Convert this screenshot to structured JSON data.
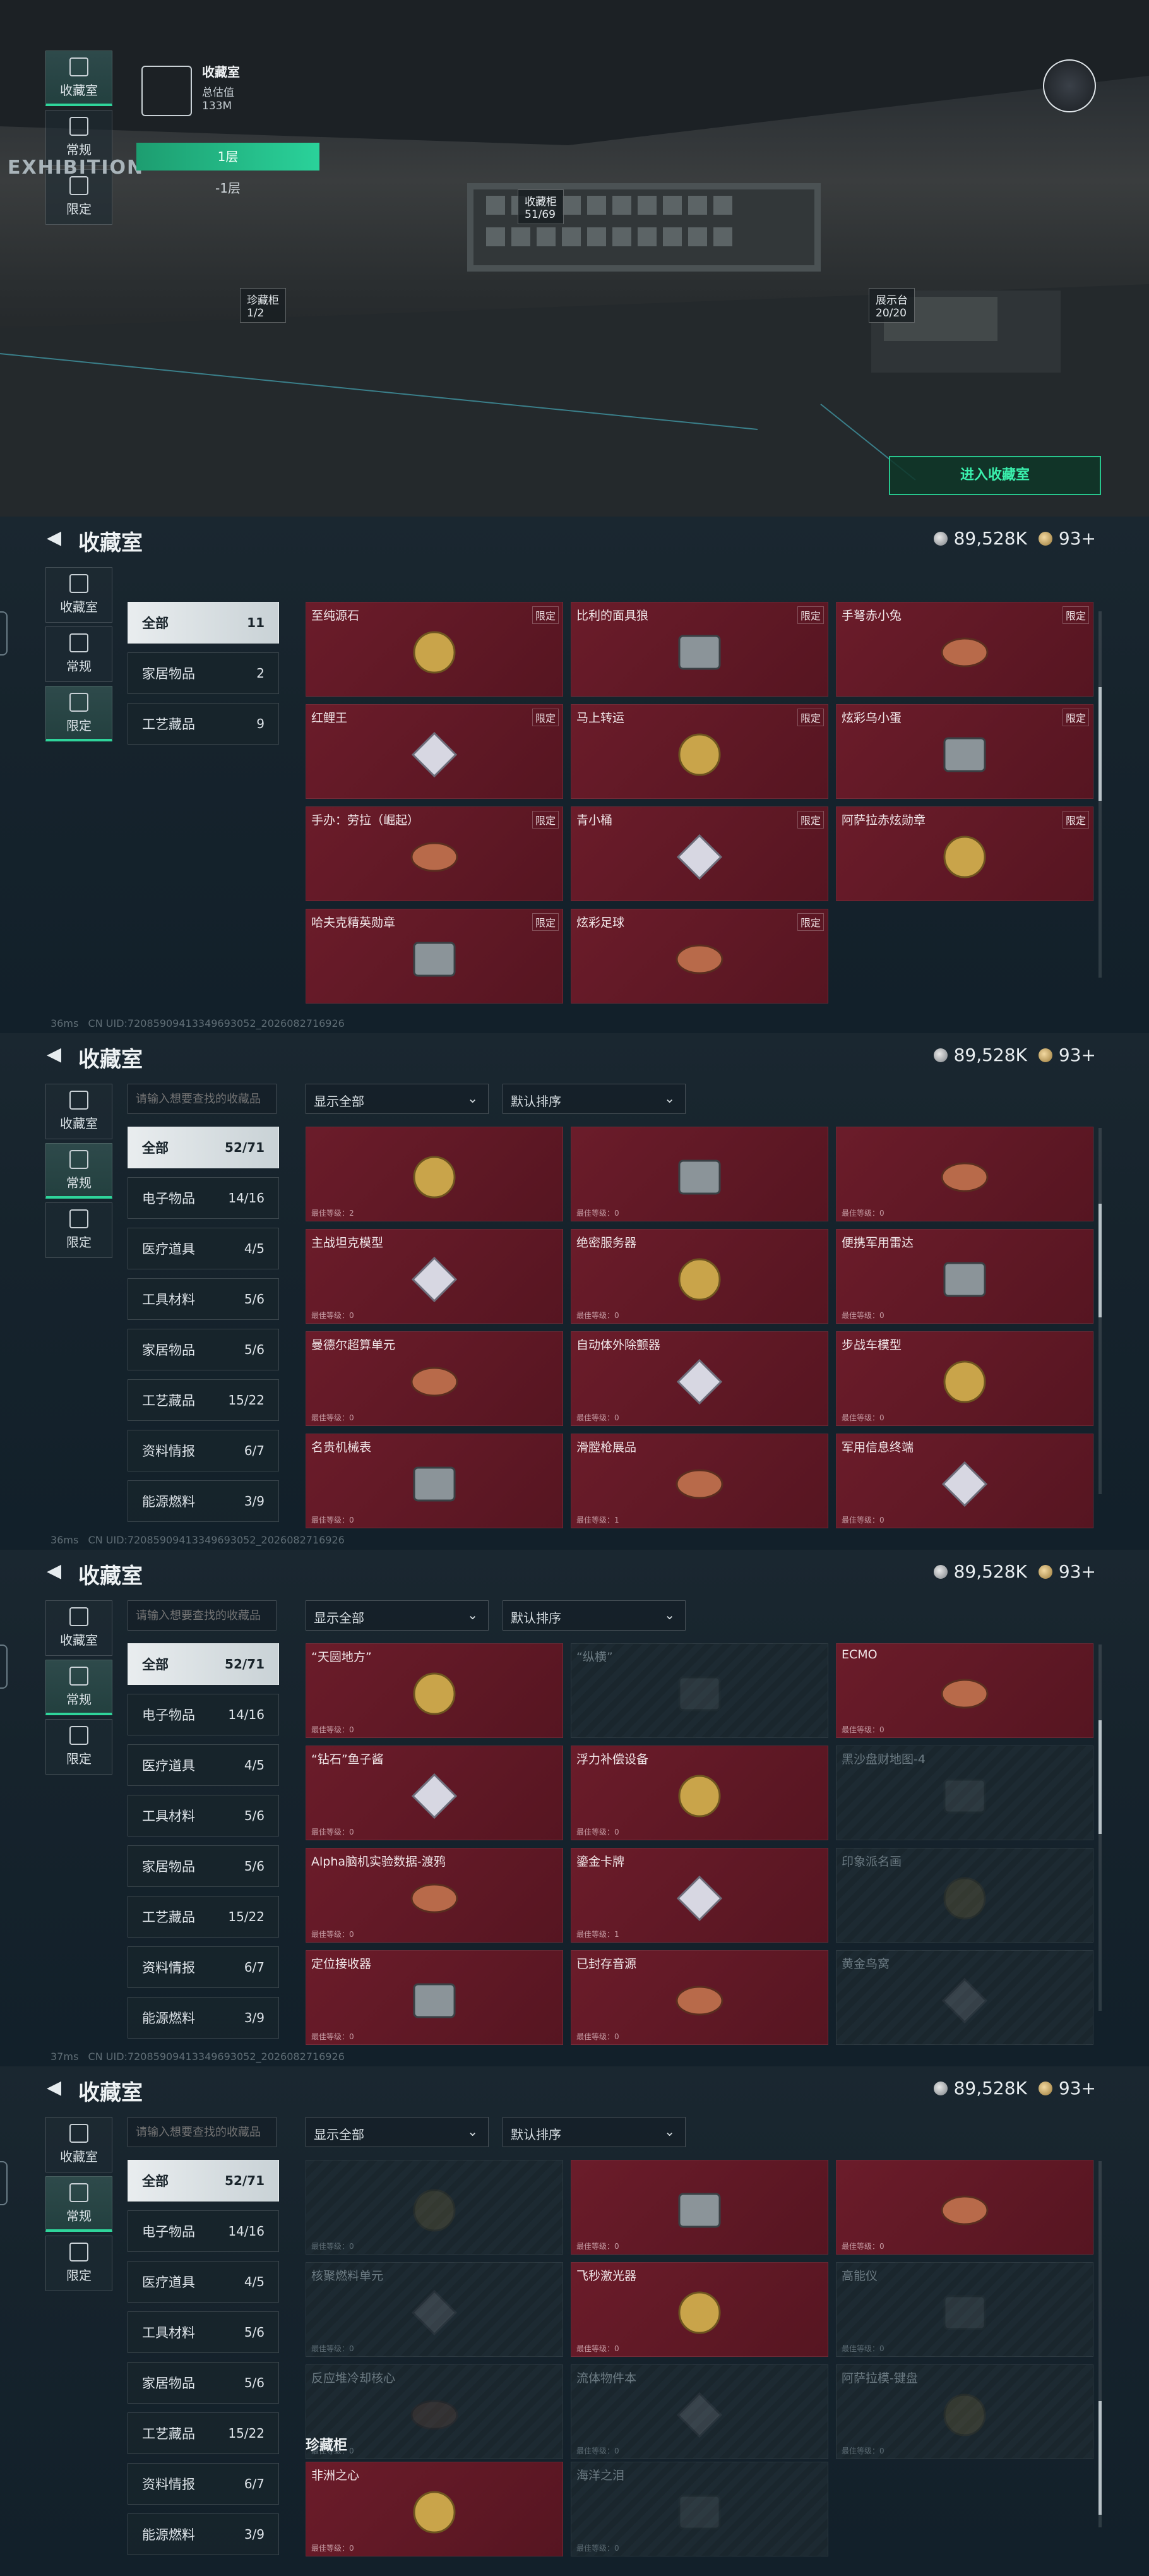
{
  "header": {
    "title": "收藏室",
    "coins": "89,528K",
    "gems": "93+"
  },
  "nav": [
    {
      "label": "收藏室"
    },
    {
      "label": "常规"
    },
    {
      "label": "限定"
    }
  ],
  "scene": {
    "room_label": "收藏室",
    "room_sub": "总估值",
    "room_value": "133M",
    "floor_1": "1层",
    "floor_neg1": "-1层",
    "exhibition": "EXHIBITION",
    "tag_cabinet": "收藏柜",
    "tag_cabinet_count": "51/69",
    "tag_treasure": "珍藏柜",
    "tag_treasure_count": "1/2",
    "tag_display": "展示台",
    "tag_display_count": "20/20",
    "enter": "进入收藏室"
  },
  "footer": {
    "uid": "CN UID:72085909413349693052_2026082716926",
    "ping2": "36ms",
    "ping3": "36ms",
    "ping4": "37ms"
  },
  "limited": {
    "cats": [
      {
        "name": "全部",
        "count": "11"
      },
      {
        "name": "家居物品",
        "count": "2"
      },
      {
        "name": "工艺藏品",
        "count": "9"
      }
    ],
    "items": [
      {
        "name": "至纯源石",
        "tag": "限定"
      },
      {
        "name": "比利的面具狼",
        "tag": "限定"
      },
      {
        "name": "手弩赤小兔",
        "tag": "限定"
      },
      {
        "name": "红鲤王",
        "tag": "限定"
      },
      {
        "name": "马上转运",
        "tag": "限定"
      },
      {
        "name": "炫彩乌小蛋",
        "tag": "限定"
      },
      {
        "name": "手办：劳拉（崛起）",
        "tag": "限定"
      },
      {
        "name": "青小桶",
        "tag": "限定"
      },
      {
        "name": "阿萨拉赤炫勋章",
        "tag": "限定"
      },
      {
        "name": "哈夫克精英勋章",
        "tag": "限定"
      },
      {
        "name": "炫彩足球",
        "tag": "限定"
      }
    ]
  },
  "regular": {
    "search_placeholder": "请输入想要查找的收藏品",
    "filter": "显示全部",
    "sort": "默认排序",
    "cats": [
      {
        "name": "全部",
        "count": "52/71"
      },
      {
        "name": "电子物品",
        "count": "14/16"
      },
      {
        "name": "医疗道具",
        "count": "4/5"
      },
      {
        "name": "工具材料",
        "count": "5/6"
      },
      {
        "name": "家居物品",
        "count": "5/6"
      },
      {
        "name": "工艺藏品",
        "count": "15/22"
      },
      {
        "name": "资料情报",
        "count": "6/7"
      },
      {
        "name": "能源燃料",
        "count": "3/9"
      }
    ],
    "items_a": [
      {
        "name": "",
        "lv": "最佳等级：2"
      },
      {
        "name": "",
        "lv": "最佳等级：0"
      },
      {
        "name": "",
        "lv": "最佳等级：0"
      },
      {
        "name": "主战坦克模型",
        "lv": "最佳等级：0"
      },
      {
        "name": "绝密服务器",
        "lv": "最佳等级：0"
      },
      {
        "name": "便携军用雷达",
        "lv": "最佳等级：0"
      },
      {
        "name": "曼德尔超算单元",
        "lv": "最佳等级：0"
      },
      {
        "name": "自动体外除颤器",
        "lv": "最佳等级：0"
      },
      {
        "name": "步战车模型",
        "lv": "最佳等级：0"
      },
      {
        "name": "名贵机械表",
        "lv": "最佳等级：0"
      },
      {
        "name": "滑膛枪展品",
        "lv": "最佳等级：1"
      },
      {
        "name": "军用信息终端",
        "lv": "最佳等级：0"
      }
    ],
    "items_b": [
      {
        "name": "“天圆地方”",
        "lv": "最佳等级：0",
        "locked": false
      },
      {
        "name": "“纵横”",
        "lv": "",
        "locked": true
      },
      {
        "name": "ECMO",
        "lv": "最佳等级：0",
        "locked": false
      },
      {
        "name": "“钻石”鱼子酱",
        "lv": "最佳等级：0",
        "locked": false
      },
      {
        "name": "浮力补偿设备",
        "lv": "最佳等级：0",
        "locked": false
      },
      {
        "name": "黑沙盘财地图-4",
        "lv": "",
        "locked": true
      },
      {
        "name": "Alpha脑机实验数据-渡鸦",
        "lv": "最佳等级：0",
        "locked": false
      },
      {
        "name": "鎏金卡牌",
        "lv": "最佳等级：1",
        "locked": false
      },
      {
        "name": "印象派名画",
        "lv": "",
        "locked": true
      },
      {
        "name": "定位接收器",
        "lv": "最佳等级：0",
        "locked": false
      },
      {
        "name": "已封存音源",
        "lv": "最佳等级：0",
        "locked": false
      },
      {
        "name": "黄金鸟窝",
        "lv": "",
        "locked": true
      }
    ],
    "items_c": [
      {
        "name": "",
        "lv": "最佳等级：0",
        "locked": true
      },
      {
        "name": "",
        "lv": "最佳等级：0",
        "locked": false
      },
      {
        "name": "",
        "lv": "最佳等级：0",
        "locked": false
      },
      {
        "name": "核聚燃料单元",
        "lv": "最佳等级：0",
        "locked": true
      },
      {
        "name": "飞秒激光器",
        "lv": "最佳等级：0",
        "locked": false
      },
      {
        "name": "高能仪",
        "lv": "最佳等级：0",
        "locked": true
      },
      {
        "name": "反应堆冷却核心",
        "lv": "最佳等级：0",
        "locked": true
      },
      {
        "name": "流体物件本",
        "lv": "最佳等级：0",
        "locked": true
      },
      {
        "name": "阿萨拉模-键盘",
        "lv": "最佳等级：0",
        "locked": true
      }
    ],
    "treasure_label": "珍藏柜",
    "treasure": [
      {
        "name": "非洲之心",
        "lv": "最佳等级：0",
        "locked": false
      },
      {
        "name": "海洋之泪",
        "lv": "最佳等级：0",
        "locked": true
      }
    ]
  }
}
